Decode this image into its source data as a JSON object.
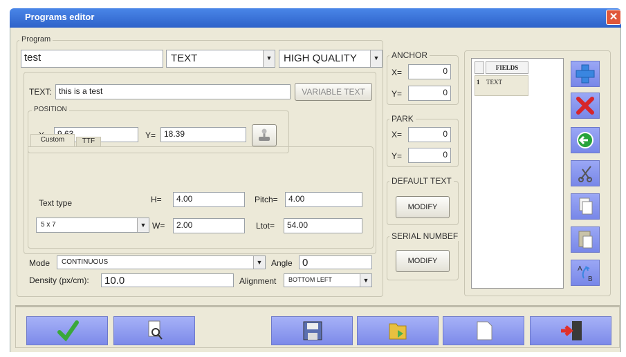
{
  "window": {
    "title": "Programs editor"
  },
  "program": {
    "legend": "Program",
    "name": "test",
    "type": "TEXT",
    "quality": "HIGH QUALITY"
  },
  "text_section": {
    "text_label": "TEXT:",
    "text_value": "this is a test",
    "variable_text_button": "VARIABLE TEXT",
    "position_legend": "POSITION",
    "x_label": "X=",
    "x_value": "9.63",
    "y_label": "Y=",
    "y_value": "18.39"
  },
  "tabs": {
    "custom": "Custom",
    "ttf": "TTF"
  },
  "font": {
    "text_type_label": "Text type",
    "h_label": "H=",
    "h_value": "4.00",
    "pitch_label": "Pitch=",
    "pitch_value": "4.00",
    "matrix": "5 x 7",
    "w_label": "W=",
    "w_value": "2.00",
    "ltot_label": "Ltot=",
    "ltot_value": "54.00"
  },
  "mode": {
    "mode_label": "Mode",
    "mode_value": "CONTINUOUS",
    "angle_label": "Angle",
    "angle_value": "0",
    "density_label": "Density (px/cm):",
    "density_value": "10.0",
    "alignment_label": "Alignment",
    "alignment_value": "BOTTOM LEFT"
  },
  "anchor": {
    "legend": "ANCHOR",
    "x_label": "X=",
    "x_value": "0",
    "y_label": "Y=",
    "y_value": "0"
  },
  "park": {
    "legend": "PARK",
    "x_label": "X=",
    "x_value": "0",
    "y_label": "Y=",
    "y_value": "0"
  },
  "default_text": {
    "legend": "DEFAULT TEXT",
    "button": "MODIFY"
  },
  "serial_number": {
    "legend": "SERIAL NUMBEF",
    "button": "MODIFY"
  },
  "fields": {
    "header": "FIELDS",
    "rows": [
      {
        "index": "1",
        "name": "TEXT"
      }
    ]
  },
  "icons": {
    "toolbar": [
      "plus-icon",
      "delete-icon",
      "back-arrow-icon",
      "cut-icon",
      "copy-icon",
      "paste-icon",
      "sort-icon"
    ],
    "bottom": [
      "checkmark-icon",
      "preview-icon",
      "save-icon",
      "open-folder-icon",
      "new-document-icon",
      "exit-icon"
    ]
  },
  "colors": {
    "title_bar": "#2e62c9",
    "button_fill": "#8a97ee",
    "panel": "#ece9d8"
  }
}
